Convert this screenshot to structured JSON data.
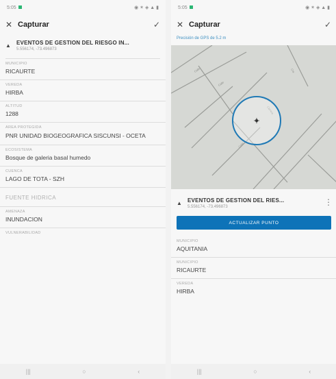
{
  "left": {
    "status": {
      "time": "5:05",
      "right": "◉ ✶ ◈ ▲ ▮"
    },
    "header": {
      "title": "Capturar"
    },
    "layer": {
      "name": "EVENTOS DE GESTION DEL RIESGO IN...",
      "subtitle": "5.556174, -73.496873"
    },
    "fields": [
      {
        "label": "MUNICIPIO",
        "value": "RICAURTE"
      },
      {
        "label": "VEREDA",
        "value": "HIRBA"
      },
      {
        "label": "ALTITUD",
        "value": "1288"
      },
      {
        "label": "AREA PROTEGIDA",
        "value": "PNR UNIDAD BIOGEOGRAFICA SISCUNSI - OCETA"
      },
      {
        "label": "ECOSISTEMA",
        "value": "Bosque de galeria basal humedo"
      },
      {
        "label": "CUENCA",
        "value": "LAGO DE TOTA - SZH"
      }
    ],
    "section": "FUENTE HIDRICA",
    "fields2": [
      {
        "label": "AMENAZA",
        "value": "INUNDACION"
      },
      {
        "label": "VULNERABILIDAD",
        "value": ""
      }
    ]
  },
  "right": {
    "status": {
      "time": "5:05",
      "right": "◉ ✶ ◈ ▲ ▮"
    },
    "header": {
      "title": "Capturar"
    },
    "precision": "Precisión de GPS de 5.2 m",
    "layer": {
      "name": "EVENTOS DE GESTION DEL RIES...",
      "subtitle": "5.556174, -73.496873"
    },
    "button": "ACTUALIZAR PUNTO",
    "fields": [
      {
        "label": "MUNICIPIO",
        "value": "AQUITANIA"
      },
      {
        "label": "MUNICIPIO",
        "value": "RICAURTE"
      },
      {
        "label": "VEREDA",
        "value": "HIRBA"
      }
    ]
  },
  "icons": {
    "close": "close-icon",
    "check": "check-icon",
    "expand": "chevron-up-icon",
    "more": "more-vertical-icon"
  },
  "colors": {
    "accent": "#0e73b8",
    "precision": "#3d8fc1",
    "map_circle": "#1f79b5"
  }
}
